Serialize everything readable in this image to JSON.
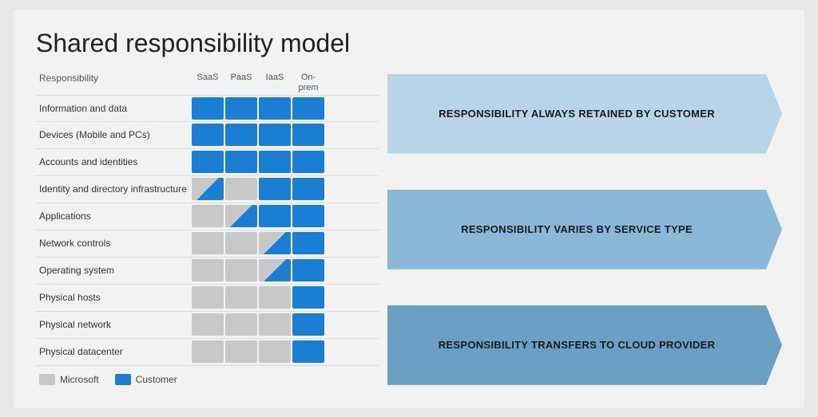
{
  "slide": {
    "title": "Shared responsibility model",
    "columns": {
      "header_label": "Responsibility",
      "col1": "SaaS",
      "col2": "PaaS",
      "col3": "IaaS",
      "col4": "On-prem"
    },
    "rows": [
      {
        "label": "Information and data",
        "cells": [
          "blue",
          "blue",
          "blue",
          "blue"
        ]
      },
      {
        "label": "Devices (Mobile and PCs)",
        "cells": [
          "blue",
          "blue",
          "blue",
          "blue"
        ]
      },
      {
        "label": "Accounts and identities",
        "cells": [
          "blue",
          "blue",
          "blue",
          "blue"
        ]
      },
      {
        "label": "Identity and directory infrastructure",
        "cells": [
          "split",
          "gray",
          "blue",
          "blue"
        ]
      },
      {
        "label": "Applications",
        "cells": [
          "gray",
          "split",
          "blue",
          "blue"
        ]
      },
      {
        "label": "Network controls",
        "cells": [
          "gray",
          "gray",
          "split",
          "blue"
        ]
      },
      {
        "label": "Operating system",
        "cells": [
          "gray",
          "gray",
          "split",
          "blue"
        ]
      },
      {
        "label": "Physical hosts",
        "cells": [
          "gray",
          "gray",
          "gray",
          "blue"
        ]
      },
      {
        "label": "Physical network",
        "cells": [
          "gray",
          "gray",
          "gray",
          "blue"
        ]
      },
      {
        "label": "Physical datacenter",
        "cells": [
          "gray",
          "gray",
          "gray",
          "blue"
        ]
      }
    ],
    "arrows": [
      {
        "id": "arrow-customer",
        "text": "RESPONSIBILITY ALWAYS RETAINED BY CUSTOMER",
        "rows": 3
      },
      {
        "id": "arrow-varies",
        "text": "RESPONSIBILITY VARIES BY SERVICE TYPE",
        "rows": 4
      },
      {
        "id": "arrow-provider",
        "text": "RESPONSIBILITY TRANSFERS TO CLOUD PROVIDER",
        "rows": 3
      }
    ],
    "legend": [
      {
        "key": "microsoft",
        "label": "Microsoft"
      },
      {
        "key": "customer",
        "label": "Customer"
      }
    ]
  }
}
